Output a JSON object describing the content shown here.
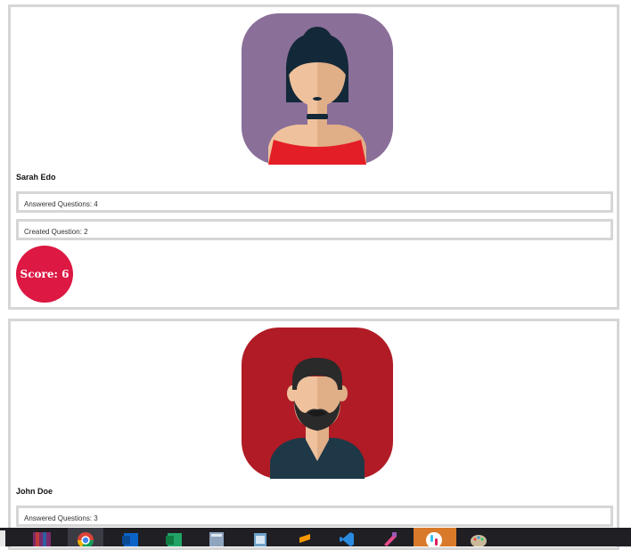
{
  "users": [
    {
      "name": "Sarah Edo",
      "answered": "Answered Questions: 4",
      "created": "Created Question: 2",
      "score": "Score: 6",
      "avatar_bg": "#8a6f99"
    },
    {
      "name": "John Doe",
      "answered": "Answered Questions: 3",
      "avatar_bg": "#b01b25"
    }
  ],
  "colors": {
    "score_badge": "#dc1843",
    "card_border": "#d6d6d6",
    "taskbar": "#1f1f24"
  },
  "taskbar": {
    "icons": [
      "file-icon",
      "winrar-icon",
      "chrome-icon",
      "outlook-icon",
      "excel-icon",
      "calculator-icon",
      "notepad-icon",
      "sublime-icon",
      "vscode-icon",
      "paint-tool-icon",
      "slack-icon",
      "paint-palette-icon"
    ]
  }
}
